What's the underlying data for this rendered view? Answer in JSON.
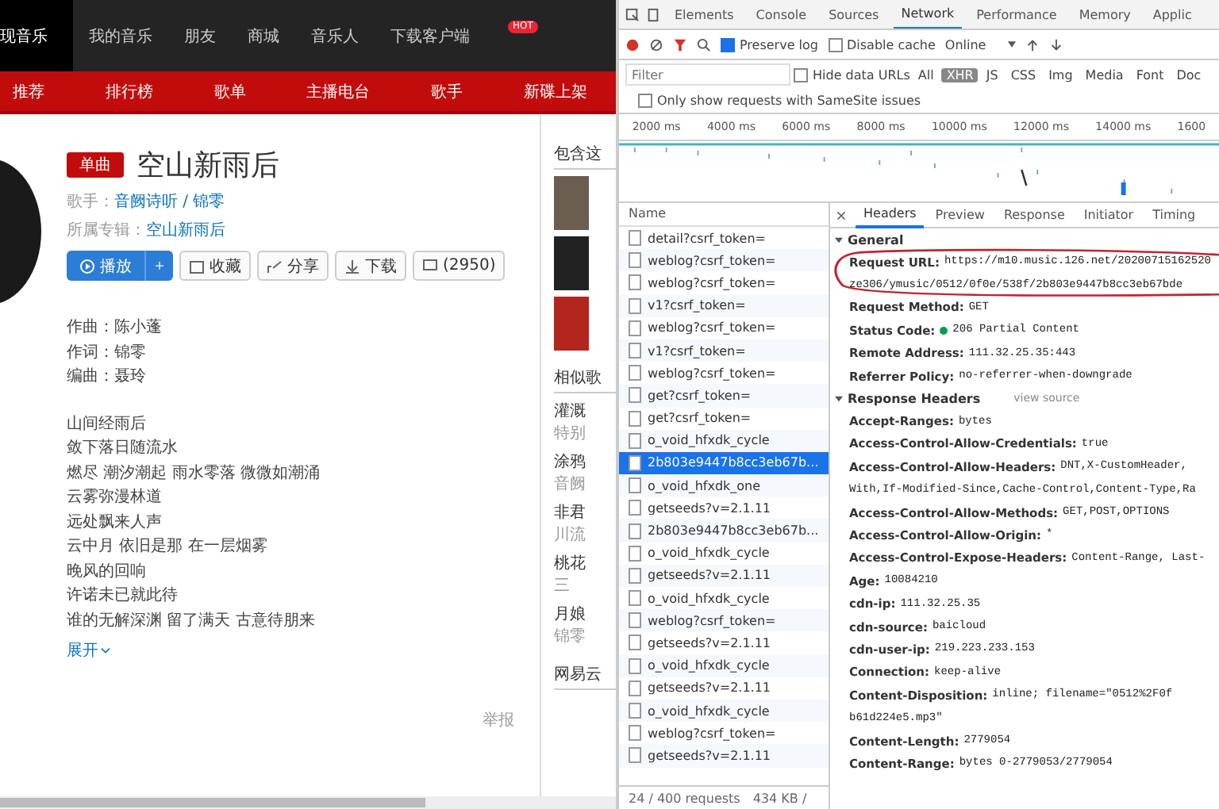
{
  "site": {
    "nav": [
      {
        "label": "现音乐",
        "selected": true
      },
      {
        "label": "我的音乐",
        "selected": false
      },
      {
        "label": "朋友",
        "selected": false
      },
      {
        "label": "商城",
        "selected": false
      },
      {
        "label": "音乐人",
        "selected": false
      },
      {
        "label": "下载客户端",
        "selected": false
      }
    ],
    "hot_badge": "HOT",
    "subnav": [
      {
        "label": "推荐",
        "selected": false
      },
      {
        "label": "排行榜",
        "selected": false
      },
      {
        "label": "歌单",
        "selected": false
      },
      {
        "label": "主播电台",
        "selected": false
      },
      {
        "label": "歌手",
        "selected": false
      },
      {
        "label": "新碟上架",
        "selected": false
      }
    ],
    "song": {
      "tag": "单曲",
      "title": "空山新雨后",
      "singer_label": "歌手：",
      "singer": "音阙诗听 / 锦零",
      "album_label": "所属专辑：",
      "album": "空山新雨后",
      "actions": [
        {
          "kind": "play",
          "label": "播放"
        },
        {
          "kind": "collect",
          "label": "收藏"
        },
        {
          "kind": "share",
          "label": "分享"
        },
        {
          "kind": "download",
          "label": "下载"
        },
        {
          "kind": "comment",
          "label": "(2950)"
        }
      ]
    },
    "credits": [
      "作曲：陈小蓬",
      "作词：锦零",
      "编曲：聂玲"
    ],
    "lyrics": [
      "山间经雨后",
      "敛下落日随流水",
      "燃尽 潮汐潮起 雨水零落 微微如潮涌",
      "云雾弥漫林道",
      "远处飘来人声",
      "云中月 依旧是那 在一层烟雾",
      "晚风的回响",
      "许诺未已就此待",
      "谁的无解深渊 留了满天 古意待朋来"
    ],
    "expand": "展开",
    "report": "举报",
    "side_headings": [
      "包含这",
      "相似歌",
      "网易云"
    ],
    "side_songs": [
      {
        "title": "灌溉",
        "sub": "特别"
      },
      {
        "title": "涂鸦",
        "sub": "音阙"
      },
      {
        "title": "非君",
        "sub": "川流"
      },
      {
        "title": "桃花",
        "sub": "三"
      },
      {
        "title": "月娘",
        "sub": "锦零"
      }
    ]
  },
  "devtools": {
    "tabs": [
      {
        "label": "Elements",
        "selected": false
      },
      {
        "label": "Console",
        "selected": false
      },
      {
        "label": "Sources",
        "selected": false
      },
      {
        "label": "Network",
        "selected": true
      },
      {
        "label": "Performance",
        "selected": false
      },
      {
        "label": "Memory",
        "selected": false
      },
      {
        "label": "Applic",
        "selected": false
      }
    ],
    "preserve_log": {
      "label": "Preserve log",
      "checked": true
    },
    "disable_cache": {
      "label": "Disable cache",
      "checked": false
    },
    "throttle": "Online",
    "filter": {
      "placeholder": "Filter"
    },
    "hide_data_urls": {
      "label": "Hide data URLs",
      "checked": false
    },
    "types": [
      {
        "label": "All",
        "selected": false
      },
      {
        "label": "XHR",
        "selected": true
      },
      {
        "label": "JS",
        "selected": false
      },
      {
        "label": "CSS",
        "selected": false
      },
      {
        "label": "Img",
        "selected": false
      },
      {
        "label": "Media",
        "selected": false
      },
      {
        "label": "Font",
        "selected": false
      },
      {
        "label": "Doc",
        "selected": false
      }
    ],
    "samesite": {
      "label": "Only show requests with SameSite issues",
      "checked": false
    },
    "ticks": [
      "2000 ms",
      "4000 ms",
      "6000 ms",
      "8000 ms",
      "10000 ms",
      "12000 ms",
      "14000 ms",
      "1600"
    ],
    "name_header": "Name",
    "requests": [
      {
        "name": "detail?csrf_token=",
        "selected": false
      },
      {
        "name": "weblog?csrf_token=",
        "selected": false
      },
      {
        "name": "weblog?csrf_token=",
        "selected": false
      },
      {
        "name": "v1?csrf_token=",
        "selected": false
      },
      {
        "name": "weblog?csrf_token=",
        "selected": false
      },
      {
        "name": "v1?csrf_token=",
        "selected": false
      },
      {
        "name": "weblog?csrf_token=",
        "selected": false
      },
      {
        "name": "get?csrf_token=",
        "selected": false
      },
      {
        "name": "get?csrf_token=",
        "selected": false
      },
      {
        "name": "o_void_hfxdk_cycle",
        "selected": false
      },
      {
        "name": "2b803e9447b8cc3eb67b...",
        "selected": true
      },
      {
        "name": "o_void_hfxdk_one",
        "selected": false
      },
      {
        "name": "getseeds?v=2.1.11",
        "selected": false
      },
      {
        "name": "2b803e9447b8cc3eb67b...",
        "selected": false
      },
      {
        "name": "o_void_hfxdk_cycle",
        "selected": false
      },
      {
        "name": "getseeds?v=2.1.11",
        "selected": false
      },
      {
        "name": "o_void_hfxdk_cycle",
        "selected": false
      },
      {
        "name": "weblog?csrf_token=",
        "selected": false
      },
      {
        "name": "getseeds?v=2.1.11",
        "selected": false
      },
      {
        "name": "o_void_hfxdk_cycle",
        "selected": false
      },
      {
        "name": "getseeds?v=2.1.11",
        "selected": false
      },
      {
        "name": "o_void_hfxdk_cycle",
        "selected": false
      },
      {
        "name": "weblog?csrf_token=",
        "selected": false
      },
      {
        "name": "getseeds?v=2.1.11",
        "selected": false
      }
    ],
    "footer": [
      "24 / 400 requests",
      "434 KB /"
    ],
    "detail_tabs": [
      {
        "label": "Headers",
        "selected": true
      },
      {
        "label": "Preview",
        "selected": false
      },
      {
        "label": "Response",
        "selected": false
      },
      {
        "label": "Initiator",
        "selected": false
      },
      {
        "label": "Timing",
        "selected": false
      }
    ],
    "general_title": "General",
    "general": [
      {
        "kind": "plain",
        "name": "Request URL:",
        "value": "https://m10.music.126.net/20200715162520",
        "continuation": "ze306/ymusic/0512/0f0e/538f/2b803e9447b8cc3eb67bde"
      },
      {
        "kind": "plain",
        "name": "Request Method:",
        "value": "GET"
      },
      {
        "kind": "status",
        "name": "Status Code:",
        "value": "206 Partial Content"
      },
      {
        "kind": "plain",
        "name": "Remote Address:",
        "value": "111.32.25.35:443"
      },
      {
        "kind": "plain",
        "name": "Referrer Policy:",
        "value": "no-referrer-when-downgrade"
      }
    ],
    "response_title": "Response Headers",
    "view_source": "view source",
    "response": [
      {
        "name": "Accept-Ranges:",
        "value": "bytes"
      },
      {
        "name": "Access-Control-Allow-Credentials:",
        "value": "true"
      },
      {
        "name": "Access-Control-Allow-Headers:",
        "value": "DNT,X-CustomHeader,",
        "continuation": "With,If-Modified-Since,Cache-Control,Content-Type,Ra"
      },
      {
        "name": "Access-Control-Allow-Methods:",
        "value": "GET,POST,OPTIONS"
      },
      {
        "name": "Access-Control-Allow-Origin:",
        "value": "*"
      },
      {
        "name": "Access-Control-Expose-Headers:",
        "value": "Content-Range, Last-"
      },
      {
        "name": "Age:",
        "value": "10084210"
      },
      {
        "name": "cdn-ip:",
        "value": "111.32.25.35"
      },
      {
        "name": "cdn-source:",
        "value": "baicloud"
      },
      {
        "name": "cdn-user-ip:",
        "value": "219.223.233.153"
      },
      {
        "name": "Connection:",
        "value": "keep-alive"
      },
      {
        "name": "Content-Disposition:",
        "value": "inline; filename=\"0512%2F0f",
        "continuation": "b61d224e5.mp3\""
      },
      {
        "name": "Content-Length:",
        "value": "2779054"
      },
      {
        "name": "Content-Range:",
        "value": "bytes 0-2779053/2779054"
      }
    ]
  }
}
